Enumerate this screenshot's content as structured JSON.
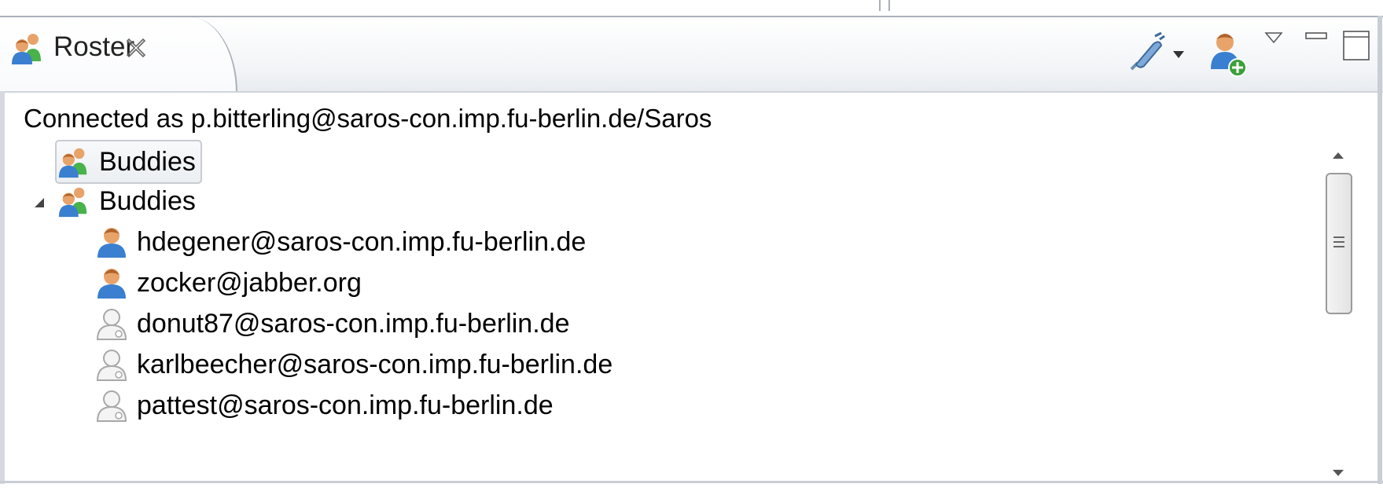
{
  "view": {
    "title": "Roster",
    "icons": {
      "view_icon": "group-icon",
      "close": "close-icon",
      "connect": "connect-plug-icon",
      "connect_menu": "dropdown-arrow-icon",
      "add_contact": "add-contact-icon",
      "view_menu": "view-menu-icon",
      "minimize": "minimize-icon",
      "maximize": "maximize-icon"
    }
  },
  "status": {
    "text": "Connected as p.bitterling@saros-con.imp.fu-berlin.de/Saros"
  },
  "tree": {
    "groups": [
      {
        "label": "Buddies",
        "selected": true,
        "expandable": false,
        "icon": "group-icon"
      },
      {
        "label": "Buddies",
        "selected": false,
        "expanded": true,
        "icon": "group-icon"
      }
    ],
    "contacts": [
      {
        "label": "hdegener@saros-con.imp.fu-berlin.de",
        "online": true,
        "icon": "online-contact-icon"
      },
      {
        "label": "zocker@jabber.org",
        "online": true,
        "icon": "online-contact-icon"
      },
      {
        "label": "donut87@saros-con.imp.fu-berlin.de",
        "online": false,
        "icon": "offline-contact-icon"
      },
      {
        "label": "karlbeecher@saros-con.imp.fu-berlin.de",
        "online": false,
        "icon": "offline-contact-icon"
      },
      {
        "label": "pattest@saros-con.imp.fu-berlin.de",
        "online": false,
        "icon": "offline-contact-icon"
      }
    ]
  },
  "colors": {
    "online_person": "#3a7fd0",
    "online_skin": "#e8a36a",
    "group_green": "#49b24a",
    "offline": "#a8a8a8",
    "border": "#a9b0bb"
  }
}
